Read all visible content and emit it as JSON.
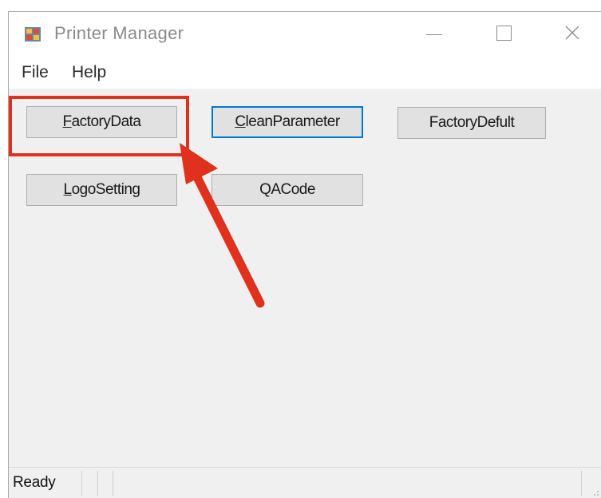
{
  "window": {
    "title": "Printer Manager",
    "icon": "printer-manager-app-icon"
  },
  "menu": {
    "file_label": "File",
    "help_label": "Help"
  },
  "buttons": {
    "factory_data": {
      "mnemonic": "F",
      "rest": "actoryData"
    },
    "clean_parameter": {
      "mnemonic": "C",
      "rest": "leanParameter"
    },
    "factory_defult": {
      "label": "FactoryDefult"
    },
    "logo_setting": {
      "mnemonic": "L",
      "rest": "ogoSetting"
    },
    "qa_code": {
      "label": "QACode"
    }
  },
  "annotation": {
    "highlight_color": "#e0301e",
    "target": "FactoryData"
  },
  "status": {
    "text": "Ready"
  },
  "colors": {
    "focus_border": "#0078d7",
    "button_face": "#e1e1e1",
    "window_bg": "#f0f0f0"
  }
}
